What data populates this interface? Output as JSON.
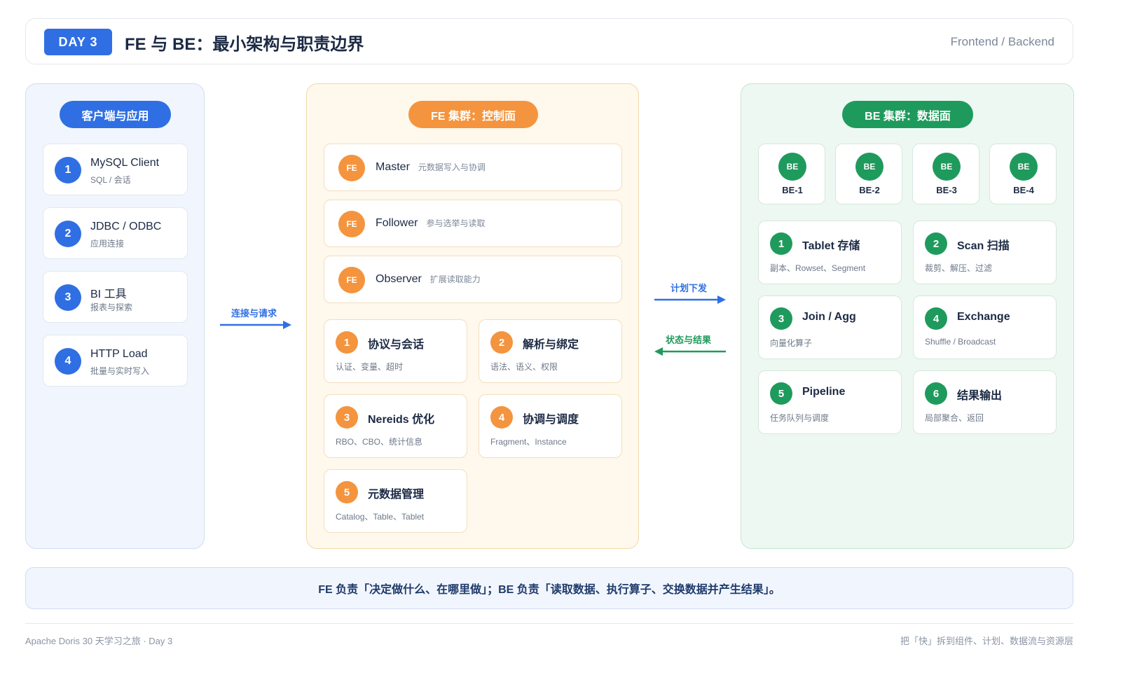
{
  "header": {
    "day_badge": "DAY 3",
    "title": "FE 与 BE：最小架构与职责边界",
    "right": "Frontend / Backend"
  },
  "client": {
    "pill": "客户端与应用",
    "items": [
      {
        "num": "1",
        "title": "MySQL Client",
        "sub": "SQL / 会话"
      },
      {
        "num": "2",
        "title": "JDBC / ODBC",
        "sub": "应用连接"
      },
      {
        "num": "3",
        "title": "BI 工具",
        "sub": "报表与探索"
      },
      {
        "num": "4",
        "title": "HTTP Load",
        "sub": "批量与实时写入"
      }
    ]
  },
  "fe": {
    "pill": "FE 集群：控制面",
    "badge": "FE",
    "roles": [
      {
        "name": "Master",
        "desc": "元数据写入与协调"
      },
      {
        "name": "Follower",
        "desc": "参与选举与读取"
      },
      {
        "name": "Observer",
        "desc": "扩展读取能力"
      }
    ],
    "modules": [
      {
        "num": "1",
        "title": "协议与会话",
        "sub": "认证、变量、超时"
      },
      {
        "num": "2",
        "title": "解析与绑定",
        "sub": "语法、语义、权限"
      },
      {
        "num": "3",
        "title": "Nereids 优化",
        "sub": "RBO、CBO、统计信息"
      },
      {
        "num": "4",
        "title": "协调与调度",
        "sub": "Fragment、Instance"
      },
      {
        "num": "5",
        "title": "元数据管理",
        "sub": "Catalog、Table、Tablet"
      }
    ]
  },
  "be": {
    "pill": "BE 集群：数据面",
    "badge": "BE",
    "nodes": [
      "BE-1",
      "BE-2",
      "BE-3",
      "BE-4"
    ],
    "ops": [
      {
        "num": "1",
        "title": "Tablet 存储",
        "sub": "副本、Rowset、Segment"
      },
      {
        "num": "2",
        "title": "Scan 扫描",
        "sub": "裁剪、解压、过滤"
      },
      {
        "num": "3",
        "title": "Join / Agg",
        "sub": "向量化算子"
      },
      {
        "num": "4",
        "title": "Exchange",
        "sub": "Shuffle / Broadcast"
      },
      {
        "num": "5",
        "title": "Pipeline",
        "sub": "任务队列与调度"
      },
      {
        "num": "6",
        "title": "结果输出",
        "sub": "局部聚合、返回"
      }
    ]
  },
  "arrows": {
    "connect": "连接与请求",
    "plan": "计划下发",
    "status": "状态与结果"
  },
  "colors": {
    "blue": "#2f6fe3",
    "orange": "#f4943e",
    "green": "#1f9a5d"
  },
  "summary": "FE 负责「决定做什么、在哪里做」；BE 负责「读取数据、执行算子、交换数据并产生结果」。",
  "footer": {
    "left": "Apache Doris 30 天学习之旅 · Day 3",
    "right": "把「快」拆到组件、计划、数据流与资源层"
  }
}
